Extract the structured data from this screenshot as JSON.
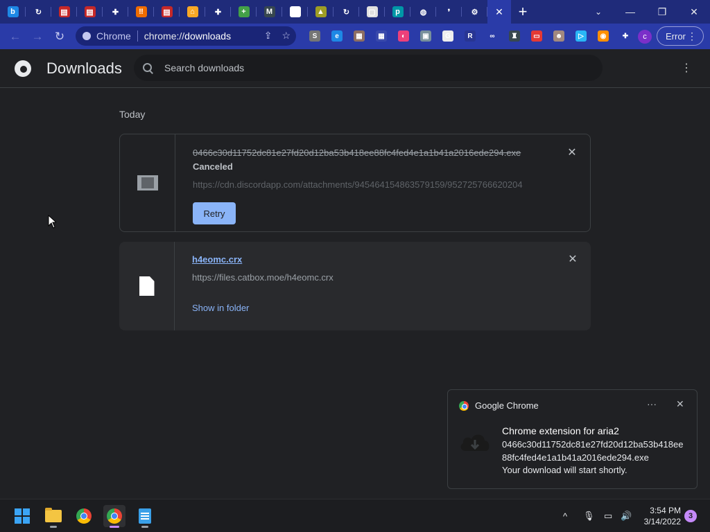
{
  "browser": {
    "tabs": [
      {
        "name": "bing",
        "icon": "b",
        "color": "#1e88e5"
      },
      {
        "name": "loading",
        "icon": "↻",
        "color": "transparent"
      },
      {
        "name": "store-1",
        "icon": "▤",
        "color": "#c62828"
      },
      {
        "name": "store-2",
        "icon": "▤",
        "color": "#c62828"
      },
      {
        "name": "extensions",
        "icon": "✚",
        "color": "transparent"
      },
      {
        "name": "tab-6",
        "icon": "‼",
        "color": "#ef6c00"
      },
      {
        "name": "store-3",
        "icon": "▤",
        "color": "#c62828"
      },
      {
        "name": "home",
        "icon": "⌂",
        "color": "#f9a825"
      },
      {
        "name": "extensions-2",
        "icon": "✚",
        "color": "transparent"
      },
      {
        "name": "add",
        "icon": "+",
        "color": "#43a047"
      },
      {
        "name": "tab-11",
        "icon": "M",
        "color": "#37474f"
      },
      {
        "name": "tab-12",
        "icon": "▬",
        "color": "#ffffff"
      },
      {
        "name": "tab-13",
        "icon": "▲",
        "color": "#9e9d24"
      },
      {
        "name": "loading-2",
        "icon": "↻",
        "color": "transparent"
      },
      {
        "name": "tab-15",
        "icon": "▢",
        "color": "#e0e0e0"
      },
      {
        "name": "tab-16",
        "icon": "p",
        "color": "#0097a7"
      },
      {
        "name": "globe",
        "icon": "◍",
        "color": "transparent"
      },
      {
        "name": "tab-18",
        "icon": "❜",
        "color": "transparent"
      },
      {
        "name": "settings",
        "icon": "⚙",
        "color": "transparent"
      }
    ],
    "active_tab_close": "✕",
    "new_tab": "+",
    "window_controls": {
      "minimize": "—",
      "maximize": "❐",
      "close": "✕"
    },
    "tab_search": "⌄",
    "nav": {
      "back": "←",
      "forward": "→",
      "reload": "↻"
    },
    "omnibox": {
      "site_label": "Chrome",
      "url_scheme": "chrome://",
      "url_host": "downloads"
    },
    "extensions": [
      {
        "name": "ext-s",
        "icon": "S",
        "color": "#757575"
      },
      {
        "name": "ext-edge",
        "icon": "e",
        "color": "#1e88e5"
      },
      {
        "name": "ext-3",
        "icon": "▦",
        "color": "#8d6e63"
      },
      {
        "name": "ext-4",
        "icon": "▦",
        "color": "#3949ab"
      },
      {
        "name": "ext-5",
        "icon": "◐",
        "color": "#ec407a"
      },
      {
        "name": "ext-6",
        "icon": "▣",
        "color": "#78909c"
      },
      {
        "name": "ext-7",
        "icon": "G",
        "color": "#eeeeee"
      },
      {
        "name": "ext-r",
        "icon": "R",
        "color": "#283593"
      },
      {
        "name": "ext-9",
        "icon": "∞",
        "color": "#2a3ba8"
      },
      {
        "name": "ext-10",
        "icon": "♜",
        "color": "#37474f"
      },
      {
        "name": "ext-11",
        "icon": "▭",
        "color": "#e53935"
      },
      {
        "name": "ext-12",
        "icon": "☻",
        "color": "#a1887f"
      },
      {
        "name": "ext-13",
        "icon": "▷",
        "color": "#29b6f6"
      },
      {
        "name": "ext-14",
        "icon": "◉",
        "color": "#ff8f00"
      },
      {
        "name": "extensions-puzzle",
        "icon": "✚",
        "color": "#2a3ba8"
      }
    ],
    "profile_initial": "c",
    "error_label": "Error"
  },
  "page": {
    "title": "Downloads",
    "search_placeholder": "Search downloads",
    "section_label": "Today",
    "downloads": [
      {
        "filename": "0466c30d11752dc81e27fd20d12ba53b418ee88fc4fed4e1a1b41a2016ede294.exe",
        "status": "Canceled",
        "url": "https://cdn.discordapp.com/attachments/945464154863579159/952725766620204",
        "action": "Retry"
      },
      {
        "filename": "h4eomc.crx",
        "url": "https://files.catbox.moe/h4eomc.crx",
        "action": "Show in folder"
      }
    ]
  },
  "notification": {
    "app_name": "Google Chrome",
    "more": "···",
    "close": "✕",
    "title": "Chrome extension for aria2",
    "line1": "0466c30d11752dc81e27fd20d12ba53b418ee",
    "line2": "88fc4fed4e1a1b41a2016ede294.exe",
    "line3": "Your download will start shortly."
  },
  "taskbar": {
    "clock_time": "3:54 PM",
    "clock_date": "3/14/2022",
    "notification_count": "3",
    "tray": {
      "chevron": "^",
      "mic": "🎙",
      "network": "▭",
      "volume": "🔊"
    }
  }
}
